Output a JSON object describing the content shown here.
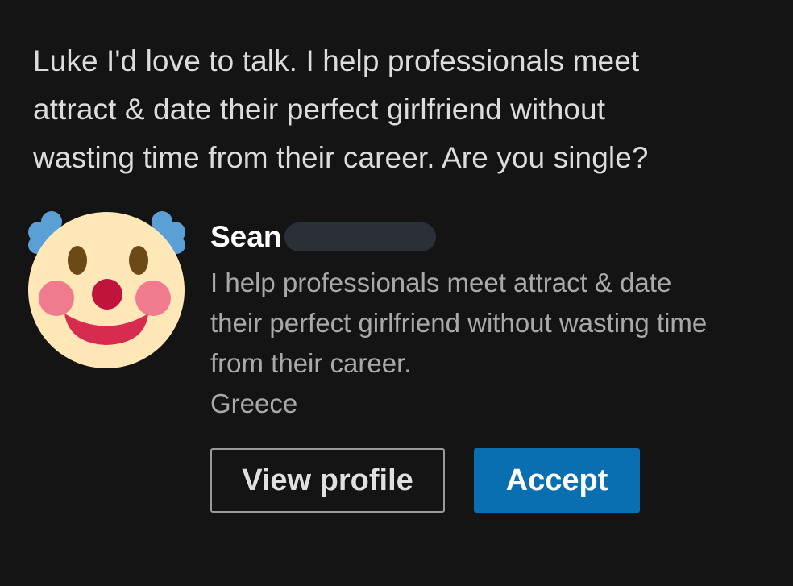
{
  "message": {
    "line1": "Luke I'd love to talk. I help professionals meet",
    "line2": "attract & date their perfect girlfriend without",
    "line3": "wasting time from their career. Are you single?"
  },
  "sender": {
    "avatar_icon": "clown-face-icon",
    "name": "Sean",
    "headline_line1": "I help professionals meet attract & date",
    "headline_line2": "their perfect girlfriend without wasting time",
    "headline_line3": "from their career.",
    "location": "Greece"
  },
  "actions": {
    "view_profile_label": "View profile",
    "accept_label": "Accept"
  },
  "colors": {
    "background": "#141414",
    "accent": "#0a6fb0",
    "secondary_text": "#a9a9a9"
  }
}
